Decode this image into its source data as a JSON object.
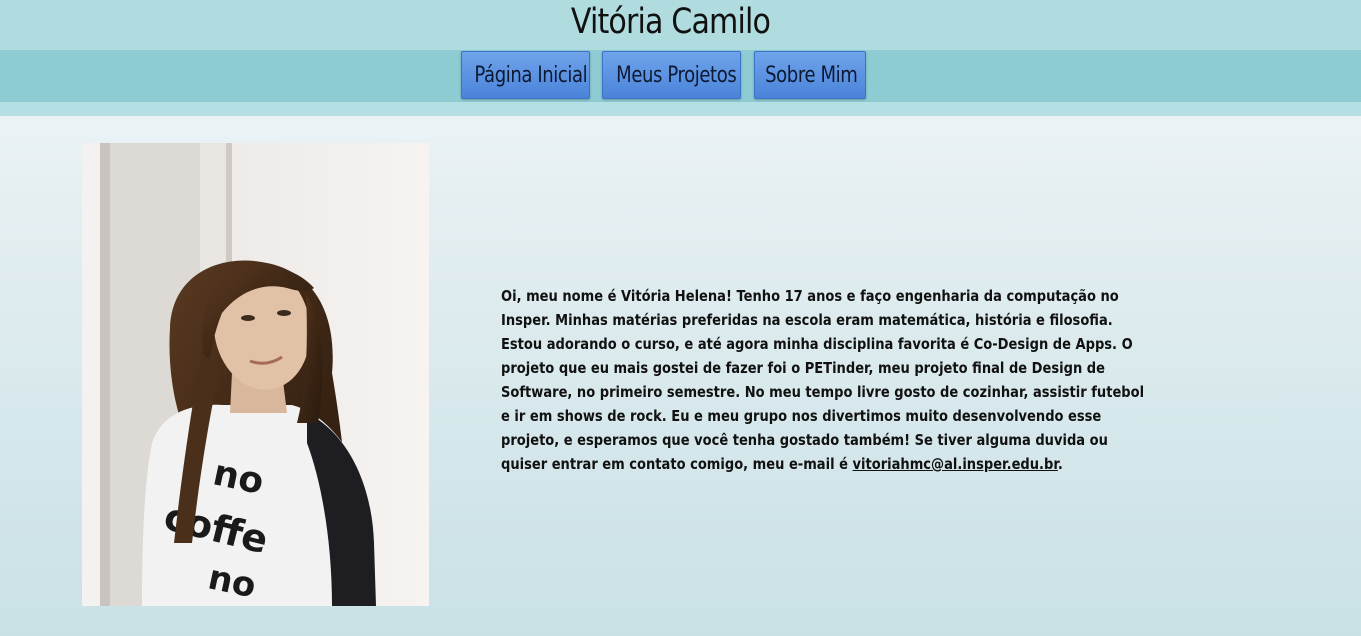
{
  "header": {
    "title": "Vitória Camilo"
  },
  "nav": {
    "items": [
      {
        "label": "Página Inicial"
      },
      {
        "label": "Meus Projetos"
      },
      {
        "label": "Sobre Mim"
      }
    ]
  },
  "about": {
    "photo_icon": "profile-photo",
    "bio_text": "Oi, meu nome é Vitória Helena! Tenho 17 anos e faço engenharia da computação no Insper. Minhas matérias preferidas na escola eram matemática, história e filosofia. Estou adorando o curso, e até agora minha disciplina favorita é Co-Design de Apps. O projeto que eu mais gostei de fazer foi o PETinder, meu projeto final de Design de Software, no primeiro semestre. No meu tempo livre gosto de cozinhar, assistir futebol e ir em shows de rock. Eu e meu grupo nos divertimos muito desenvolvendo esse projeto, e esperamos que você tenha gostado também! Se tiver alguma duvida ou quiser entrar em contato comigo, meu e-mail é",
    "email": "vitoriahmc@al.insper.edu.br",
    "trailing": ".",
    "shirt_text": [
      "no",
      "coffe",
      "no"
    ]
  },
  "colors": {
    "header_bg": "#b0dce0",
    "nav_bg": "#8ecbd3",
    "button_bg": "#5a92e2",
    "text": "#111111"
  }
}
